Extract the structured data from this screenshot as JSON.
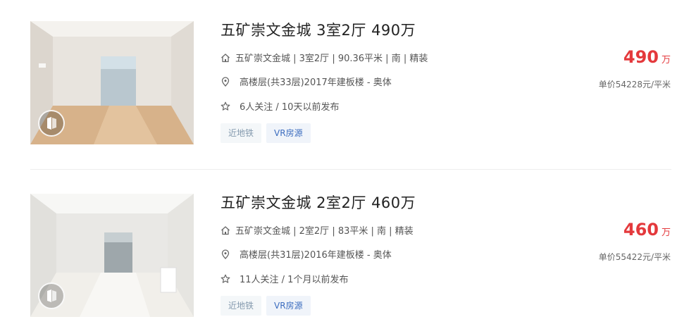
{
  "listings": [
    {
      "title": "五矿崇文金城 3室2厅 490万",
      "house_info": "五矿崇文金城 | 3室2厅 | 90.36平米 | 南 | 精装",
      "position_info": "高楼层(共33层)2017年建板楼 - 奥体",
      "follow_info": "6人关注 / 10天以前发布",
      "tags": [
        "近地铁",
        "VR房源"
      ],
      "total_price": "490",
      "price_unit": "万",
      "unit_price": "单价54228元/平米"
    },
    {
      "title": "五矿崇文金城 2室2厅 460万",
      "house_info": "五矿崇文金城 | 2室2厅 | 83平米 | 南 | 精装",
      "position_info": "高楼层(共31层)2016年建板楼 - 奥体",
      "follow_info": "11人关注 / 1个月以前发布",
      "tags": [
        "近地铁",
        "VR房源"
      ],
      "total_price": "460",
      "price_unit": "万",
      "unit_price": "单价55422元/平米"
    }
  ],
  "colors": {
    "price": "#e4393c",
    "tag_vr": "#3c6dbf",
    "tag_subway": "#849aae"
  },
  "icons": {
    "house": "house-icon",
    "position": "location-pin-icon",
    "follow": "star-icon",
    "vr": "vr-badge-icon"
  }
}
